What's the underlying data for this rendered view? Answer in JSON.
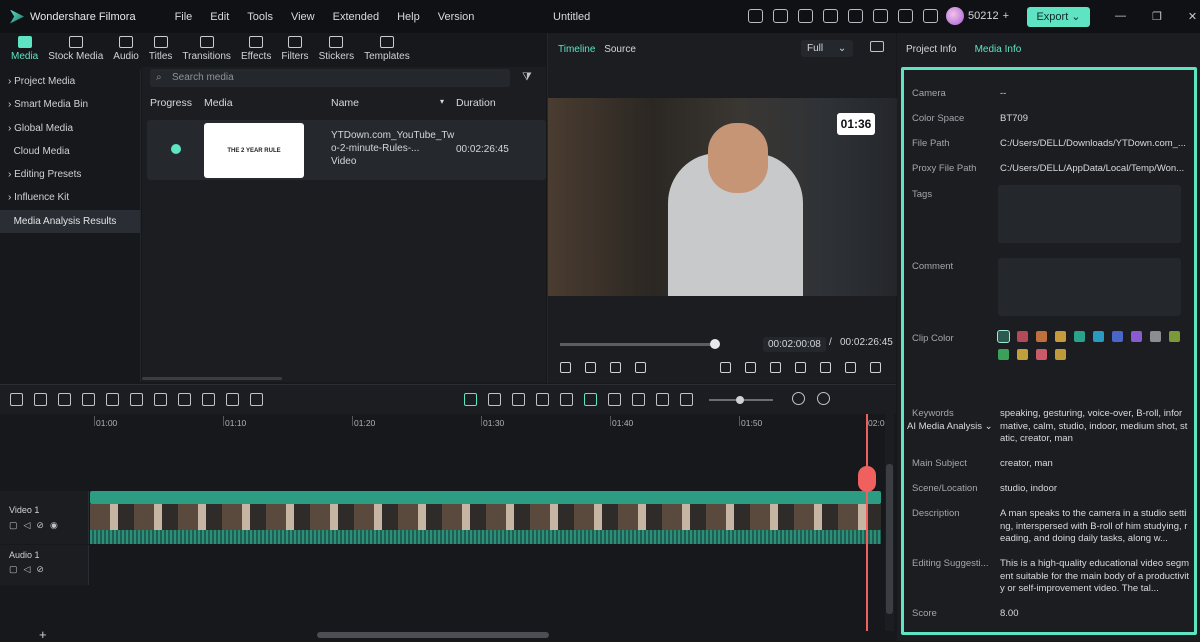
{
  "titlebar": {
    "app_name": "Wondershare Filmora",
    "menu": [
      "File",
      "Edit",
      "Tools",
      "View",
      "Extended",
      "Help",
      "Version"
    ],
    "doc_title": "Untitled",
    "credits": "50212",
    "export": "Export"
  },
  "media_tabs": [
    "Media",
    "Stock Media",
    "Audio",
    "Titles",
    "Transitions",
    "Effects",
    "Filters",
    "Stickers",
    "Templates"
  ],
  "sidebar": [
    "Project Media",
    "Smart Media Bin",
    "Global Media",
    "Cloud Media",
    "Editing Presets",
    "Influence Kit",
    "Media Analysis Results"
  ],
  "browser": {
    "search_placeholder": "Search media",
    "headers": {
      "progress": "Progress",
      "media": "Media",
      "name": "Name",
      "duration": "Duration"
    },
    "item": {
      "thumb_text": "THE 2 YEAR RULE",
      "name_line1": "YTDown.com_YouTube_Tw",
      "name_line2": "o-2-minute-Rules-...",
      "type": "Video",
      "duration": "00:02:26:45"
    }
  },
  "preview": {
    "tabs": [
      "Timeline",
      "Source"
    ],
    "quality": "Full",
    "overlay_timer": "01:36",
    "current_time": "00:02:00:08",
    "separator": "/",
    "total_time": "00:02:26:45",
    "progress": 0.82
  },
  "timeline": {
    "ticks": [
      "01:00",
      "01:10",
      "01:20",
      "01:30",
      "01:40",
      "01:50",
      "02:0"
    ],
    "tracks": {
      "video": "Video 1",
      "audio": "Audio 1"
    }
  },
  "right_panel": {
    "tabs": [
      "Project Info",
      "Media Info"
    ],
    "camera": {
      "label": "Camera",
      "value": "--"
    },
    "color_space": {
      "label": "Color Space",
      "value": "BT709"
    },
    "file_path": {
      "label": "File Path",
      "value": "C:/Users/DELL/Downloads/YTDown.com_..."
    },
    "proxy_path": {
      "label": "Proxy File Path",
      "value": "C:/Users/DELL/AppData/Local/Temp/Won..."
    },
    "tags": {
      "label": "Tags"
    },
    "comment": {
      "label": "Comment"
    },
    "clip_color": {
      "label": "Clip Color",
      "swatches": [
        "#2c5a50",
        "#b34a5a",
        "#c0703a",
        "#c79a3a",
        "#2aa38a",
        "#2a9bc0",
        "#4a66c8",
        "#8a5ad0",
        "#8a8d92",
        "#7a9a3a",
        "#3aa05a",
        "#c0a03a",
        "#c85a6a",
        "#c09a3a"
      ]
    },
    "ai_heading": "AI Media Analysis",
    "keywords": {
      "label": "Keywords",
      "value": "speaking, gesturing, voice-over, B-roll, informative, calm, studio, indoor, medium shot, static, creator, man"
    },
    "main_subject": {
      "label": "Main Subject",
      "value": "creator, man"
    },
    "scene": {
      "label": "Scene/Location",
      "value": "studio, indoor"
    },
    "description": {
      "label": "Description",
      "value": "A man speaks to the camera in a studio setting, interspersed with B-roll of him studying, reading, and doing daily tasks, along w..."
    },
    "editing": {
      "label": "Editing Suggesti...",
      "value": "This is a high-quality educational video segment suitable for the main body of a productivity or self-improvement video. The tal..."
    },
    "score": {
      "label": "Score",
      "value": "8.00"
    }
  }
}
